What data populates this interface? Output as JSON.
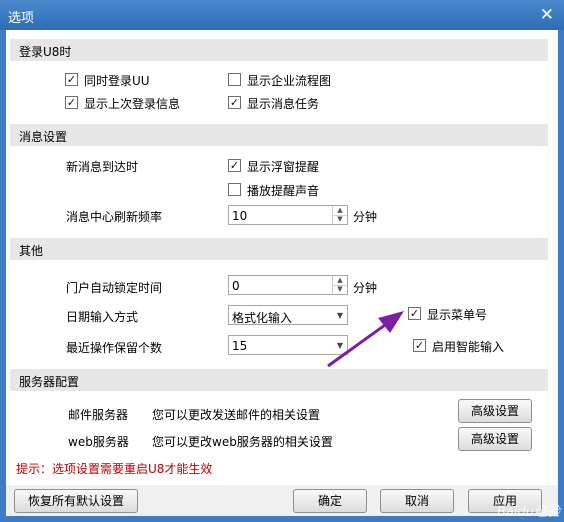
{
  "window": {
    "title": "选项"
  },
  "sections": {
    "login": "登录U8时",
    "messages": "消息设置",
    "other": "其他",
    "server": "服务器配置"
  },
  "login": {
    "concurrent_uu": {
      "label": "同时登录UU",
      "checked": true
    },
    "show_flowchart": {
      "label": "显示企业流程图",
      "checked": false
    },
    "show_last_login": {
      "label": "显示上次登录信息",
      "checked": true
    },
    "show_message_tasks": {
      "label": "显示消息任务",
      "checked": true
    }
  },
  "messages": {
    "new_message_label": "新消息到达时",
    "show_popup": {
      "label": "显示浮窗提醒",
      "checked": true
    },
    "play_sound": {
      "label": "播放提醒声音",
      "checked": false
    },
    "refresh_label": "消息中心刷新频率",
    "refresh_value": "10",
    "refresh_unit": "分钟"
  },
  "other": {
    "auto_lock_label": "门户自动锁定时间",
    "auto_lock_value": "0",
    "auto_lock_unit": "分钟",
    "date_input_label": "日期输入方式",
    "date_input_value": "格式化输入",
    "recent_ops_label": "最近操作保留个数",
    "recent_ops_value": "15",
    "show_menu_number": {
      "label": "显示菜单号",
      "checked": true
    },
    "smart_input": {
      "label": "启用智能输入",
      "checked": true
    }
  },
  "server": {
    "mail_label": "邮件服务器",
    "mail_desc": "您可以更改发送邮件的相关设置",
    "mail_button": "高级设置",
    "web_label": "web服务器",
    "web_desc": "您可以更改web服务器的相关设置",
    "web_button": "高级设置"
  },
  "hint": "提示：选项设置需要重启U8才能生效",
  "footer": {
    "restore_defaults": "恢复所有默认设置",
    "ok": "确定",
    "cancel": "取消",
    "apply": "应用"
  },
  "watermark": "Baidu经验",
  "colors": {
    "titlebar": "#3d7cc4",
    "hint": "#c00000",
    "arrow": "#7b1fa2"
  }
}
